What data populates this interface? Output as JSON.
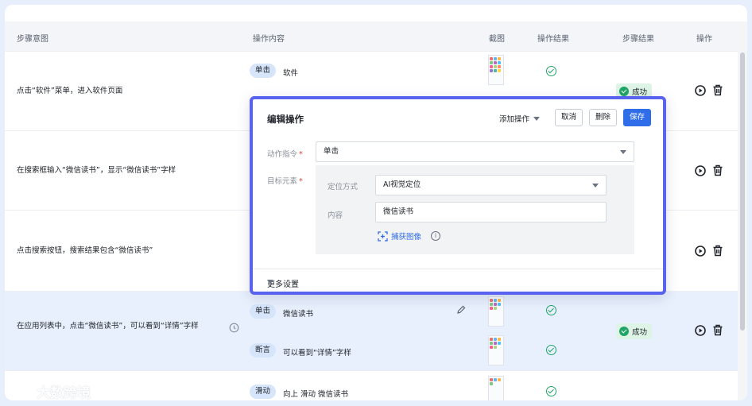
{
  "header": {
    "col_intent": "步骤意图",
    "col_content": "操作内容",
    "col_screenshot": "截图",
    "col_result": "操作结果",
    "col_step_result": "步骤结果",
    "col_action": "操作"
  },
  "rows": [
    {
      "intent": "点击“软件”菜单，进入软件页面",
      "op_chip": "单击",
      "op_text": "软件",
      "step_result": "成功"
    },
    {
      "intent": "在搜索框输入“微信读书”，显示“微信读书”字样"
    },
    {
      "intent": "点击搜索按钮，搜索结果包含“微信读书”"
    },
    {
      "intent": "在应用列表中，点击“微信读书”，可以看到“详情”字样",
      "op1_chip": "单击",
      "op1_text": "微信读书",
      "op2_chip": "断言",
      "op2_text": "可以看到“详情”字样",
      "step_result": "成功"
    },
    {
      "op_chip": "滑动",
      "op_text": "向上 滑动 微信读书"
    }
  ],
  "modal": {
    "title": "编辑操作",
    "add_op": "添加操作",
    "cancel": "取消",
    "delete": "删除",
    "save": "保存",
    "action_label": "动作指令",
    "action_value": "单击",
    "target_label": "目标元素",
    "locate_label": "定位方式",
    "locate_value": "AI视觉定位",
    "content_label": "内容",
    "content_value": "微信读书",
    "capture": "捕获图像",
    "more": "更多设置"
  },
  "watermark": "大数跨境",
  "colors": {
    "accent": "#2f6ee8",
    "modal_border": "#5a63f0",
    "success": "#21a566"
  }
}
